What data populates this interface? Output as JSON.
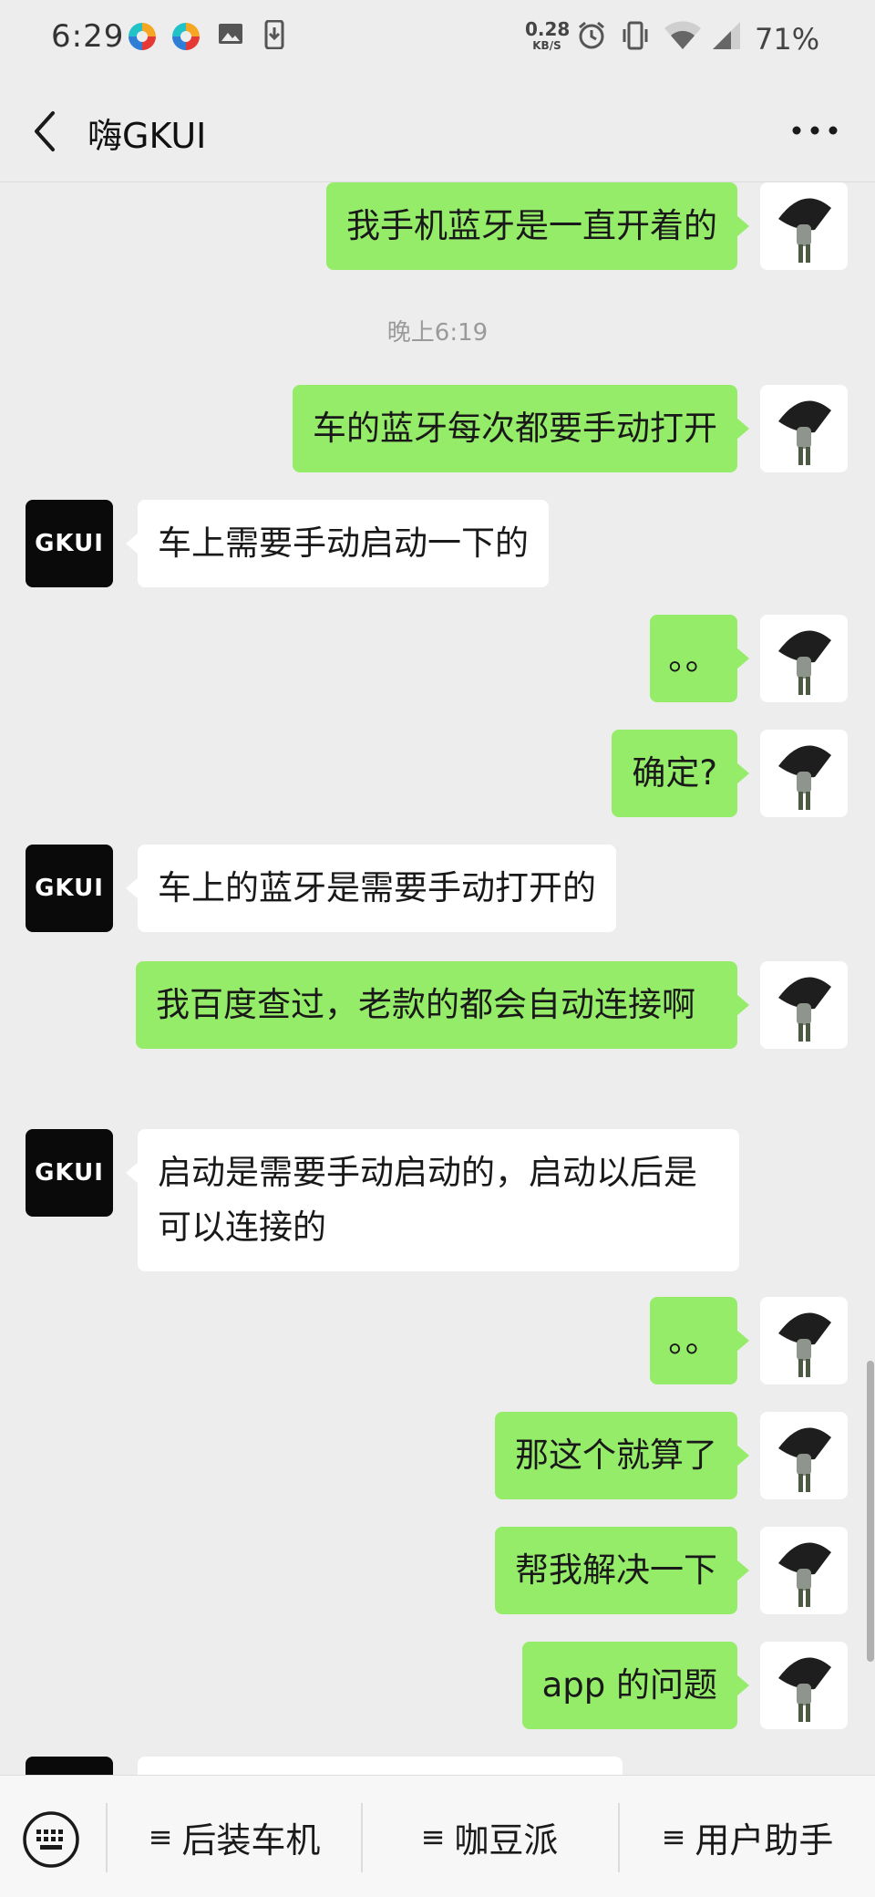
{
  "status_bar": {
    "time": "6:29",
    "net_speed_value": "0.28",
    "net_speed_unit": "KB/S",
    "battery": "71%"
  },
  "header": {
    "title": "嗨GKUI"
  },
  "chat": {
    "timestamp": "晚上6:19",
    "contact_avatar_text": "GKUI",
    "messages": [
      {
        "from": "me",
        "text": "我手机蓝牙是一直开着的"
      },
      {
        "from": "me",
        "text": "车的蓝牙每次都要手动打开"
      },
      {
        "from": "gk",
        "text": "车上需要手动启动一下的"
      },
      {
        "from": "me",
        "text": "。。"
      },
      {
        "from": "me",
        "text": "确定?"
      },
      {
        "from": "gk",
        "text": "车上的蓝牙是需要手动打开的"
      },
      {
        "from": "me",
        "text": "我百度查过，老款的都会自动连接啊"
      },
      {
        "from": "gk",
        "text": "启动是需要手动启动的，启动以后是可以连接的"
      },
      {
        "from": "me",
        "text": "。。"
      },
      {
        "from": "me",
        "text": "那这个就算了"
      },
      {
        "from": "me",
        "text": "帮我解决一下"
      },
      {
        "from": "me",
        "text": "app 的问题"
      }
    ]
  },
  "menu": {
    "items": [
      {
        "glyph": "≡",
        "label": "后装车机"
      },
      {
        "glyph": "≡",
        "label": "咖豆派"
      },
      {
        "glyph": "≡",
        "label": "用户助手"
      }
    ]
  },
  "colors": {
    "background": "#ededed",
    "my_bubble": "#95ec69",
    "their_bubble": "#ffffff",
    "contact_avatar": "#0a0a0a"
  },
  "icons": {
    "back": "chevron-left-icon",
    "more": "more-dots-icon",
    "keyboard": "keyboard-icon",
    "menu": "menu-lines-icon"
  }
}
